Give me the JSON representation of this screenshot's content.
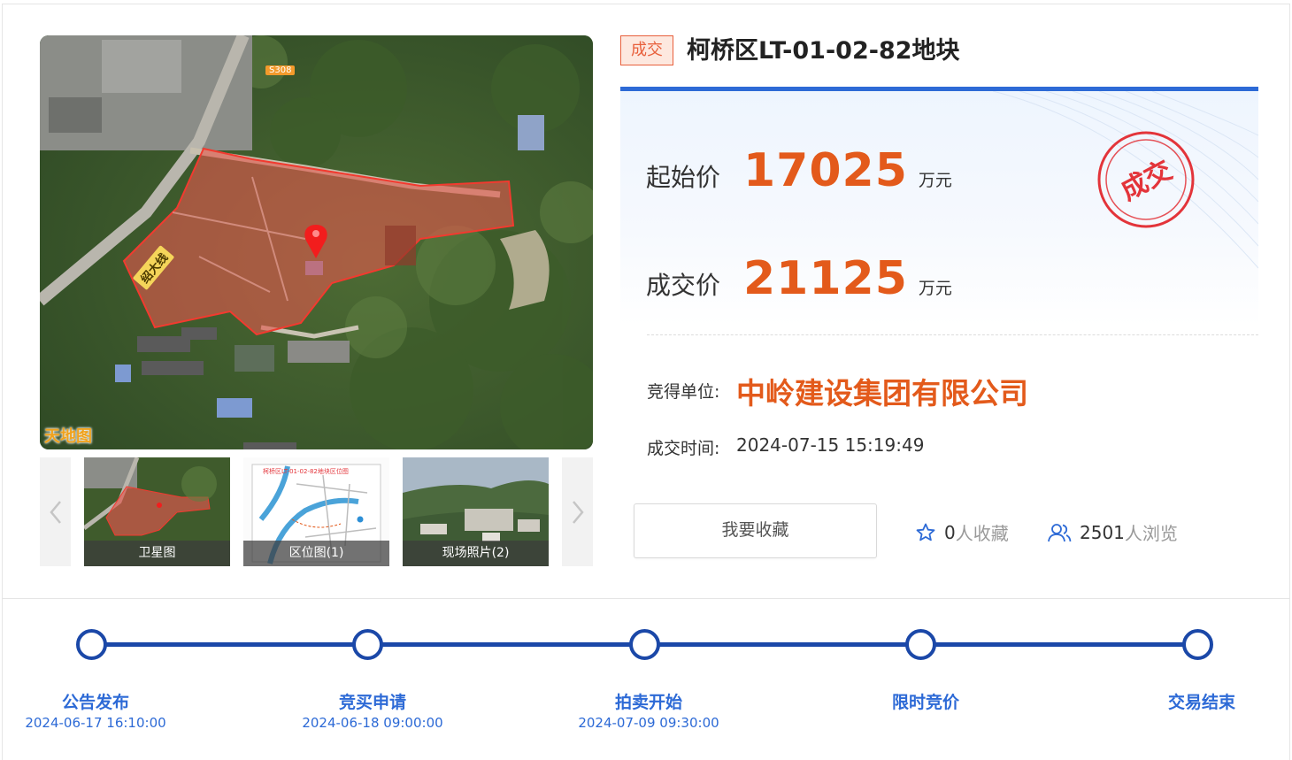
{
  "gallery": {
    "watermark": "天地图",
    "road_label": "绍大线",
    "road_code": "S308",
    "thumbnails": [
      {
        "caption": "卫星图"
      },
      {
        "caption": "区位图(1)"
      },
      {
        "caption": "现场照片(2)"
      }
    ],
    "map_thumb_title": "柯桥区LT-01-02-82地块区位图",
    "prev_icon": "chevron-left-icon",
    "next_icon": "chevron-right-icon"
  },
  "status_tag": "成交",
  "title": "柯桥区LT-01-02-82地块",
  "prices": {
    "start_label": "起始价",
    "start_value": "17025",
    "deal_label": "成交价",
    "deal_value": "21125",
    "unit": "万元",
    "stamp_text": "成交"
  },
  "winner": {
    "label": "竞得单位:",
    "name": "中岭建设集团有限公司"
  },
  "deal_time": {
    "label": "成交时间:",
    "value": "2024-07-15 15:19:49"
  },
  "actions": {
    "favorite_button": "我要收藏",
    "favorites_count": "0",
    "favorites_suffix": "人收藏",
    "views_count": "2501",
    "views_suffix": "人浏览"
  },
  "timeline": [
    {
      "label": "公告发布",
      "date": "2024-06-17 16:10:00"
    },
    {
      "label": "竞买申请",
      "date": "2024-06-18 09:00:00"
    },
    {
      "label": "拍卖开始",
      "date": "2024-07-09 09:30:00"
    },
    {
      "label": "限时竞价",
      "date": ""
    },
    {
      "label": "交易结束",
      "date": ""
    }
  ],
  "colors": {
    "accent_blue": "#2d6ad6",
    "timeline_blue": "#1b48a8",
    "price_orange": "#e35a1b",
    "stamp_red": "#e3343a"
  }
}
